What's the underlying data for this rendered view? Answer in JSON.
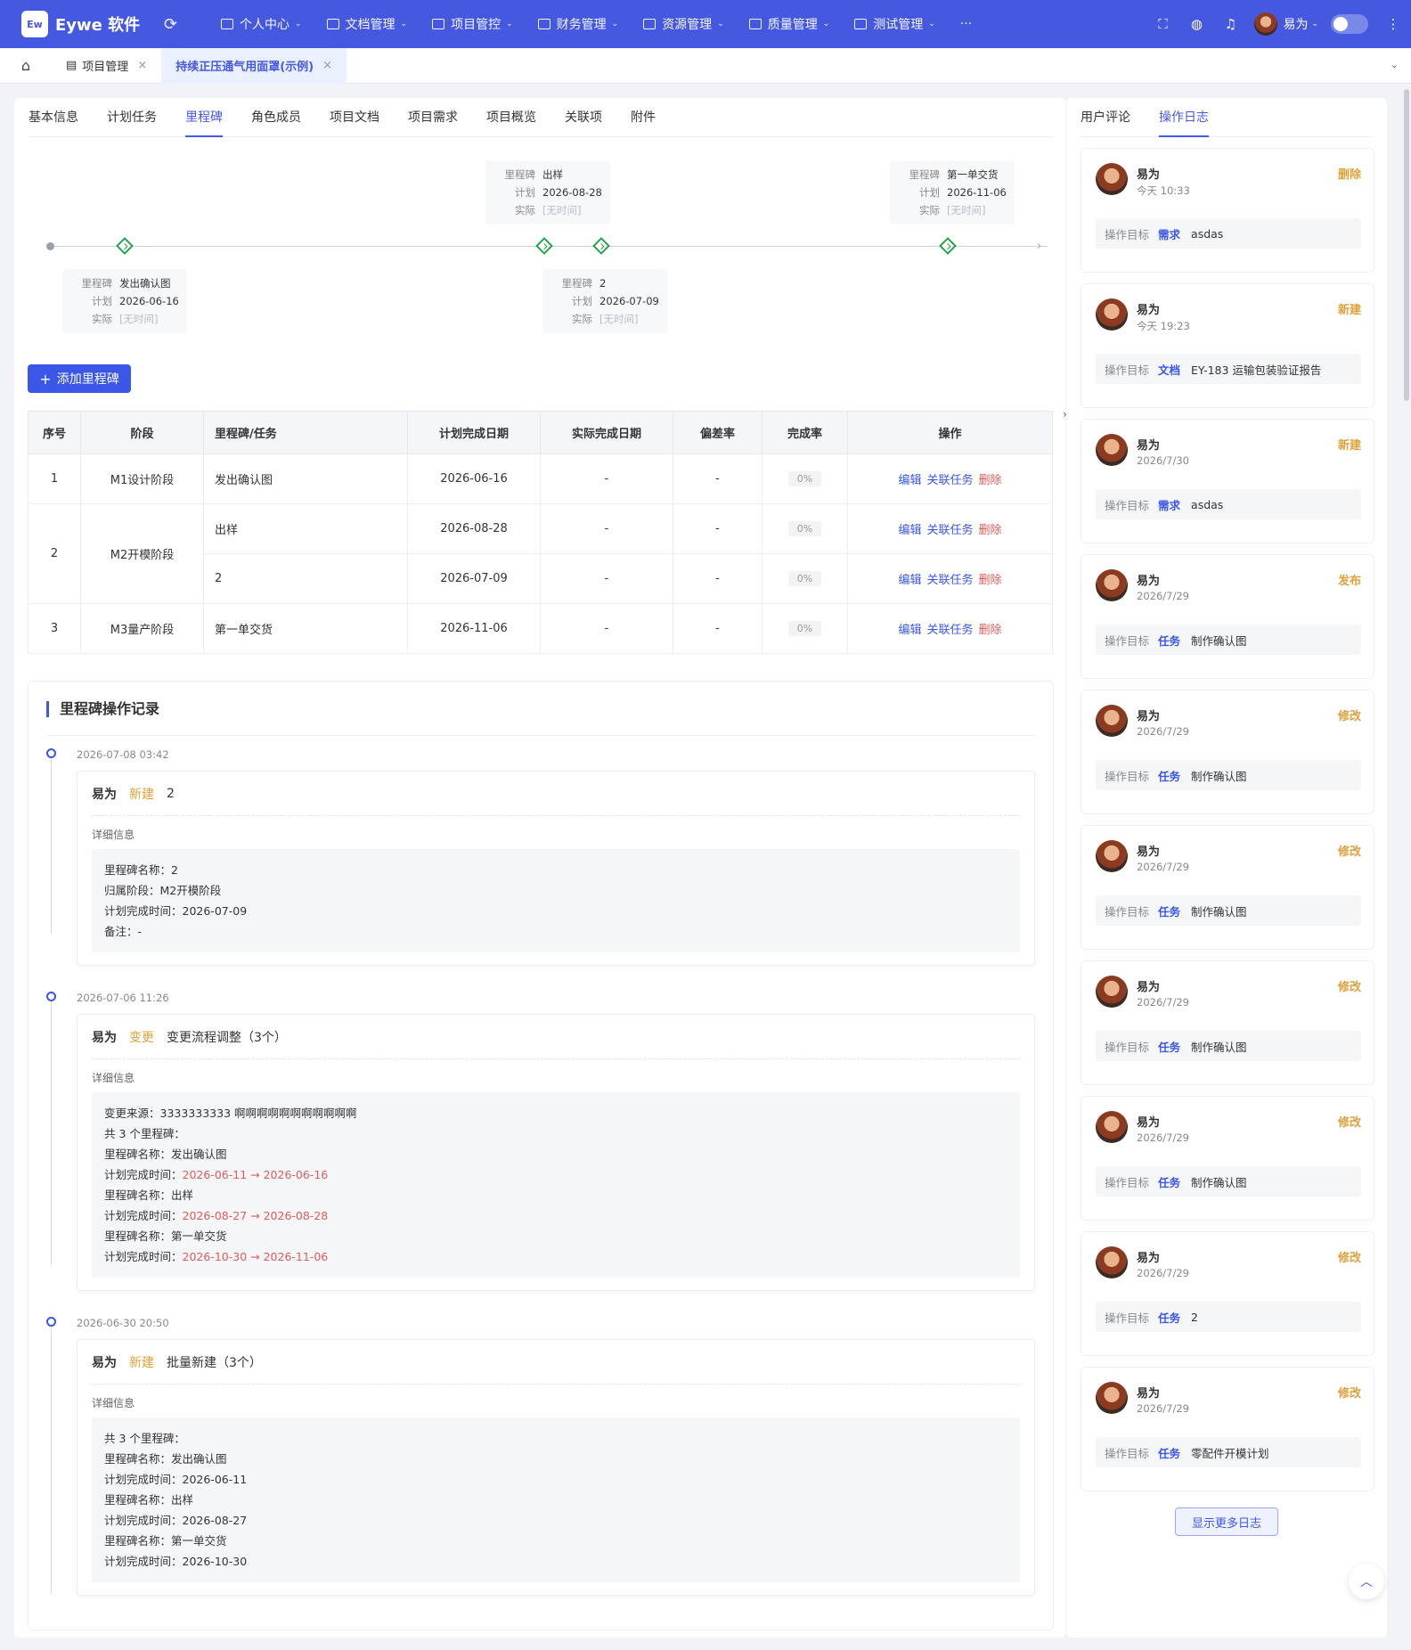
{
  "app": {
    "logo_text": "Ew",
    "name": "Eywe 软件"
  },
  "topnav": {
    "items": [
      {
        "label": "个人中心",
        "icon": "home-icon"
      },
      {
        "label": "文档管理",
        "icon": "folder-icon"
      },
      {
        "label": "项目管控",
        "icon": "project-icon"
      },
      {
        "label": "财务管理",
        "icon": "finance-icon"
      },
      {
        "label": "资源管理",
        "icon": "resource-icon"
      },
      {
        "label": "质量管理",
        "icon": "shield-icon"
      },
      {
        "label": "测试管理",
        "icon": "test-icon"
      }
    ],
    "more": "···",
    "user": "易为"
  },
  "tabbar": {
    "tabs": [
      {
        "label": "项目管理"
      },
      {
        "label": "持续正压通气用面罩(示例)"
      }
    ]
  },
  "detail_tabs": [
    "基本信息",
    "计划任务",
    "里程碑",
    "角色成员",
    "项目文档",
    "项目需求",
    "项目概览",
    "关联项",
    "附件"
  ],
  "timeline": {
    "labels": {
      "name": "里程碑",
      "plan": "计划",
      "actual": "实际",
      "none": "[无时间]"
    },
    "milestones": [
      {
        "name": "发出确认图",
        "plan": "2026-06-16",
        "actual": "[无时间]"
      },
      {
        "name": "出样",
        "plan": "2026-08-28",
        "actual": "[无时间]"
      },
      {
        "name": "2",
        "plan": "2026-07-09",
        "actual": "[无时间]"
      },
      {
        "name": "第一单交货",
        "plan": "2026-11-06",
        "actual": "[无时间]"
      }
    ]
  },
  "add_button": "添加里程碑",
  "table": {
    "headers": [
      "序号",
      "阶段",
      "里程碑/任务",
      "计划完成日期",
      "实际完成日期",
      "偏差率",
      "完成率",
      "操作"
    ],
    "rows": [
      {
        "no": "1",
        "stage": "M1设计阶段",
        "task": "发出确认图",
        "plan": "2026-06-16",
        "actual": "-",
        "dev": "-",
        "rate": "0%"
      },
      {
        "no": "2",
        "stage": "M2开模阶段",
        "task": "出样",
        "plan": "2026-08-28",
        "actual": "-",
        "dev": "-",
        "rate": "0%"
      },
      {
        "no": "",
        "stage": "",
        "task": "2",
        "plan": "2026-07-09",
        "actual": "-",
        "dev": "-",
        "rate": "0%"
      },
      {
        "no": "3",
        "stage": "M3量产阶段",
        "task": "第一单交货",
        "plan": "2026-11-06",
        "actual": "-",
        "dev": "-",
        "rate": "0%"
      }
    ],
    "ops": {
      "edit": "编辑",
      "link": "关联任务",
      "delete": "删除"
    }
  },
  "log": {
    "title": "里程碑操作记录",
    "detail_label": "详细信息",
    "entries": [
      {
        "time": "2026-07-08 03:42",
        "user": "易为",
        "action": "新建",
        "summary": "2",
        "lines": [
          "里程碑名称：2",
          "归属阶段：M2开模阶段",
          "计划完成时间：2026-07-09",
          "备注：-"
        ]
      },
      {
        "time": "2026-07-06 11:26",
        "user": "易为",
        "action": "变更",
        "summary": "变更流程调整（3个）",
        "lines": [
          "变更来源：3333333333 啊啊啊啊啊啊啊啊啊啊啊",
          "共 3 个里程碑：",
          "里程碑名称：发出确认图",
          "计划完成时间：",
          "里程碑名称：出样",
          "计划完成时间：",
          "里程碑名称：第一单交货",
          "计划完成时间："
        ],
        "changes": [
          "2026-06-11 → 2026-06-16",
          "2026-08-27 → 2026-08-28",
          "2026-10-30 → 2026-11-06"
        ]
      },
      {
        "time": "2026-06-30 20:50",
        "user": "易为",
        "action": "新建",
        "summary": "批量新建（3个）",
        "lines": [
          "共 3 个里程碑：",
          "里程碑名称：发出确认图",
          "计划完成时间：2026-06-11",
          "里程碑名称：出样",
          "计划完成时间：2026-08-27",
          "里程碑名称：第一单交货",
          "计划完成时间：2026-10-30"
        ]
      }
    ]
  },
  "side": {
    "tabs": [
      "用户评论",
      "操作日志"
    ],
    "target_label": "操作目标",
    "items": [
      {
        "user": "易为",
        "time": "今天 10:33",
        "action": "删除",
        "type": "需求",
        "name": "asdas"
      },
      {
        "user": "易为",
        "time": "今天 19:23",
        "action": "新建",
        "type": "文档",
        "name": "EY-183 运输包装验证报告"
      },
      {
        "user": "易为",
        "time": "2026/7/30",
        "action": "新建",
        "type": "需求",
        "name": "asdas"
      },
      {
        "user": "易为",
        "time": "2026/7/29",
        "action": "发布",
        "type": "任务",
        "name": "制作确认图"
      },
      {
        "user": "易为",
        "time": "2026/7/29",
        "action": "修改",
        "type": "任务",
        "name": "制作确认图"
      },
      {
        "user": "易为",
        "time": "2026/7/29",
        "action": "修改",
        "type": "任务",
        "name": "制作确认图"
      },
      {
        "user": "易为",
        "time": "2026/7/29",
        "action": "修改",
        "type": "任务",
        "name": "制作确认图"
      },
      {
        "user": "易为",
        "time": "2026/7/29",
        "action": "修改",
        "type": "任务",
        "name": "制作确认图"
      },
      {
        "user": "易为",
        "time": "2026/7/29",
        "action": "修改",
        "type": "任务",
        "name": "2"
      },
      {
        "user": "易为",
        "time": "2026/7/29",
        "action": "修改",
        "type": "任务",
        "name": "零配件开模计划"
      }
    ],
    "more_button": "显示更多日志"
  }
}
